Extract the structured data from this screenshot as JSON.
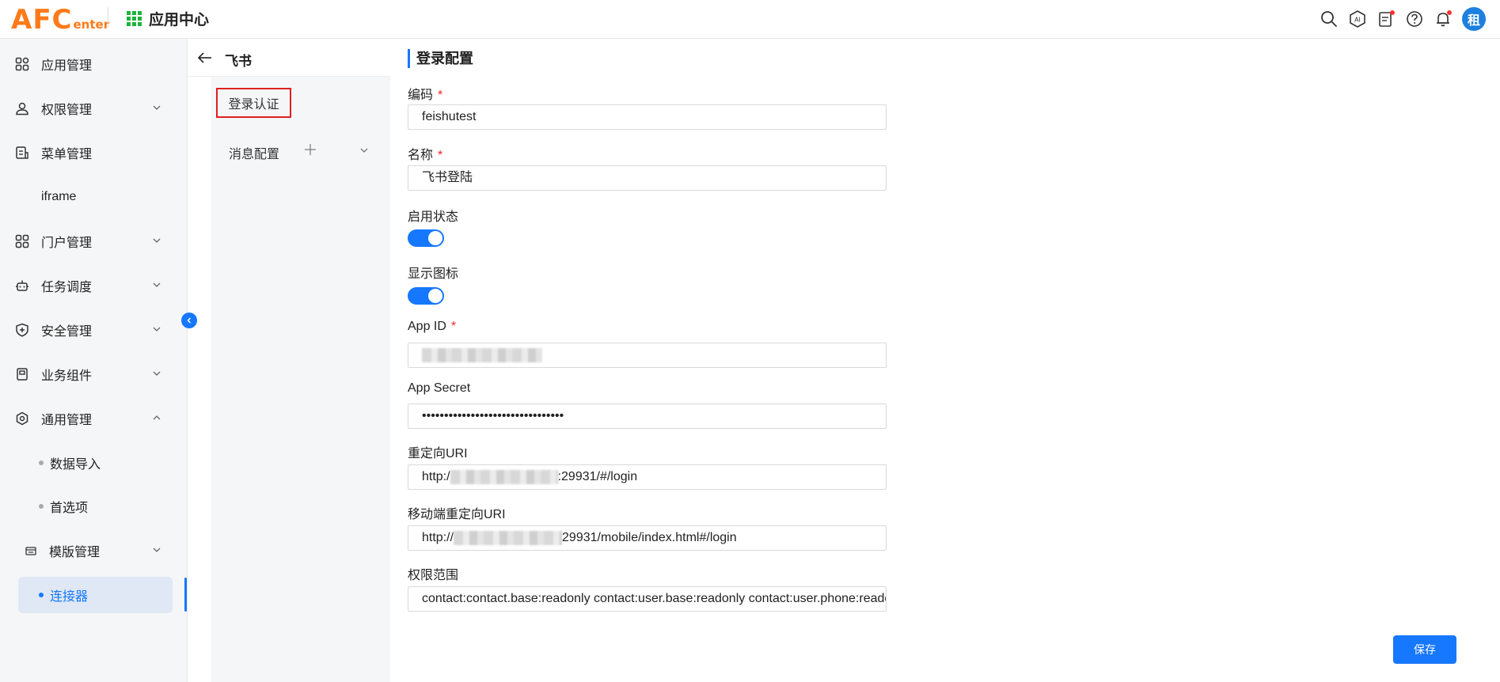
{
  "header": {
    "logo_big": "AFC",
    "logo_small": "enter",
    "app_center_title": "应用中心",
    "avatar_text": "租"
  },
  "sidebar": {
    "items": [
      {
        "label": "应用管理"
      },
      {
        "label": "权限管理"
      },
      {
        "label": "菜单管理"
      },
      {
        "label": "iframe"
      },
      {
        "label": "门户管理"
      },
      {
        "label": "任务调度"
      },
      {
        "label": "安全管理"
      },
      {
        "label": "业务组件"
      },
      {
        "label": "通用管理"
      }
    ],
    "sub_items": [
      {
        "label": "数据导入"
      },
      {
        "label": "首选项"
      }
    ],
    "template_group": {
      "label": "模版管理"
    },
    "active_item": {
      "label": "连接器"
    }
  },
  "middle": {
    "title": "飞书",
    "items": [
      {
        "label": "登录认证"
      },
      {
        "label": "消息配置"
      }
    ]
  },
  "form": {
    "section_title": "登录配置",
    "fields": {
      "code": {
        "label": "编码",
        "value": "feishutest"
      },
      "name": {
        "label": "名称",
        "value": "飞书登陆"
      },
      "enable": {
        "label": "启用状态"
      },
      "show_icon": {
        "label": "显示图标"
      },
      "app_id": {
        "label": "App ID"
      },
      "app_secret": {
        "label": "App Secret",
        "value": "••••••••••••••••••••••••••••••••"
      },
      "redirect": {
        "label": "重定向URI",
        "prefix": "http:/",
        "suffix": ":29931/#/login"
      },
      "mobile_redirect": {
        "label": "移动端重定向URI",
        "prefix": "http://",
        "suffix": "29931/mobile/index.html#/login"
      },
      "scope": {
        "label": "权限范围",
        "value": "contact:contact.base:readonly contact:user.base:readonly contact:user.phone:readonly"
      }
    },
    "required_mark": "*",
    "save_label": "保存"
  },
  "colors": {
    "accent": "#1677ff",
    "brand": "#ff7a1a",
    "highlight_border": "#e0201e"
  }
}
